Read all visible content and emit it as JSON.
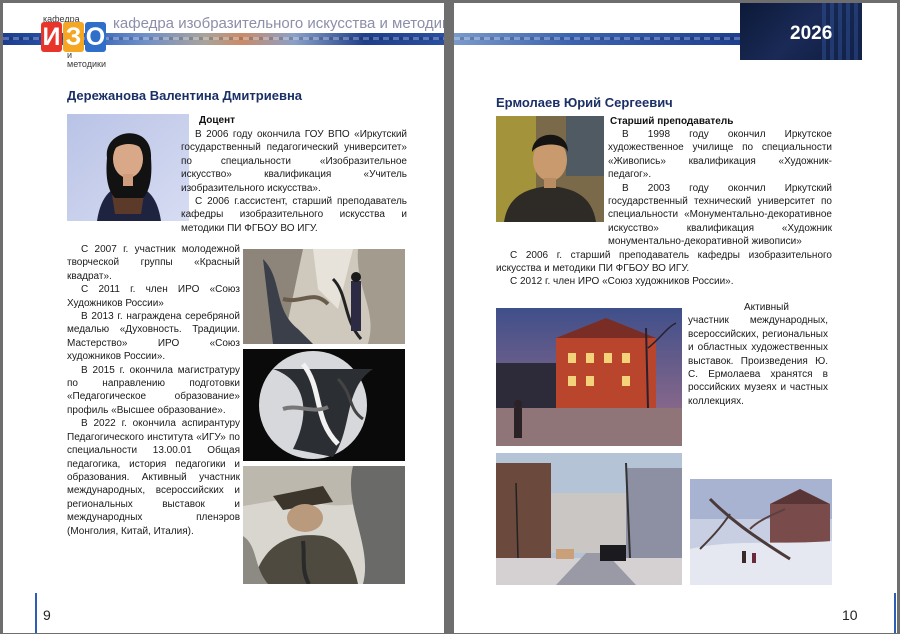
{
  "header": {
    "logo_top": "кафедра",
    "logo_letters": [
      "И",
      "З",
      "О"
    ],
    "logo_bottom": "и методики",
    "department": "кафедра изобразительного искусства и методики",
    "year": "2026"
  },
  "left": {
    "name": "Дережанова Валентина Дмитриевна",
    "role": "Доцент",
    "bio_top": [
      "В 2006 году окончила ГОУ ВПО «Иркутский государственный педагогический университет» по специальности «Изобразительное искусство» квалификация «Учитель изобразительного искусства».",
      "С 2006 г.ассистент, старший преподаватель кафедры изобразительного искусства и методики ПИ ФГБОУ ВО ИГУ."
    ],
    "bio_column": [
      "С 2007 г. участник молодежной творческой группы «Красный квадрат».",
      "С 2011 г. член ИРО «Союз Художников России»",
      "В 2013 г. награждена серебряной медалью «Духовность. Традиции. Мастерство» ИРО «Союз художников России».",
      "В 2015 г. окончила магистратуру по направлению подготовки «Педагогическое образование» профиль «Высшее образование».",
      "В 2022 г. окончила аспирантуру Педагогического института «ИГУ» по специальности 13.00.01 Общая педагогика, история педагогики и образования. Активный участник международных, всероссийских и региональных выставок и международных пленэров (Монголия, Китай, Италия)."
    ],
    "page_number": "9"
  },
  "right": {
    "name": "Ермолаев Юрий Сергеевич",
    "role": "Старший преподаватель",
    "bio_top": [
      "В 1998 году окончил Иркутское художественное училище по специальности «Живопись» квалификация «Художник-педагог».",
      "В 2003 году окончил Иркутский государственный технический университет по специальности «Монументально-декоративное искусство» квалификация «Художник монументально-декоративной живописи»",
      "С 2006 г. старший преподаватель кафедры изобразительного искусства и методики ПИ ФГБОУ ВО ИГУ.",
      "С 2012 г. член ИРО «Союз художников России»."
    ],
    "bio_side": "Активный участник международных, всероссийских, региональных и областных художественных выставок. Произведения Ю. С. Ермолаева хранятся в российских музеях и частных коллекциях.",
    "page_number": "10"
  }
}
